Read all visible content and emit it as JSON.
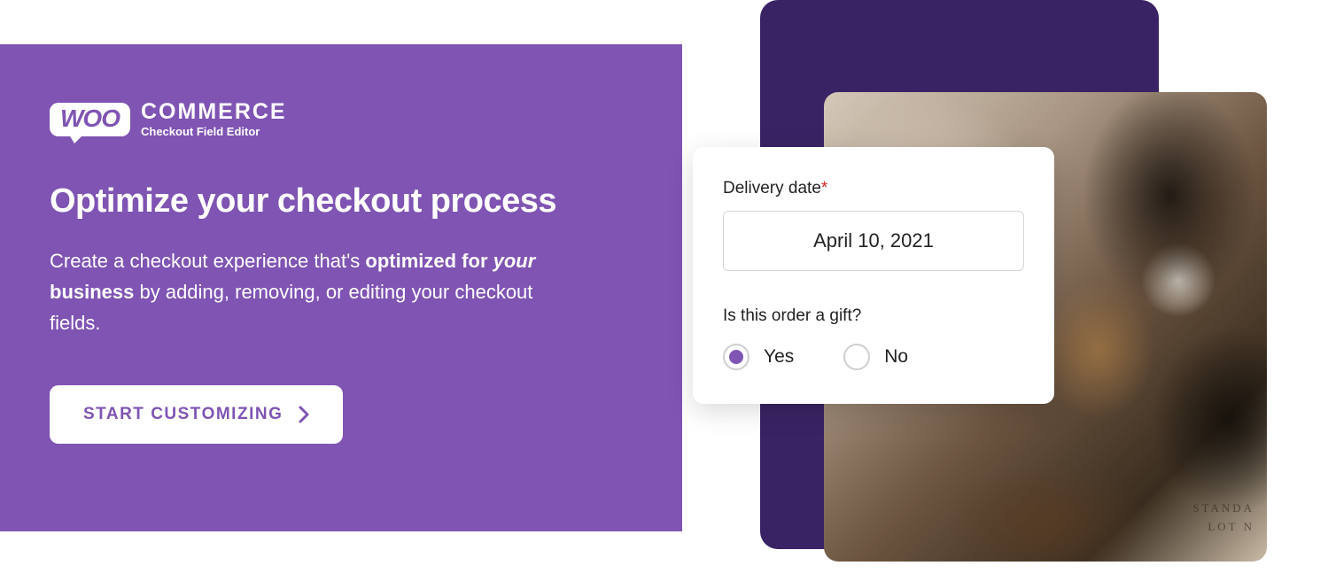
{
  "logo": {
    "woo": "WOO",
    "commerce": "COMMERCE",
    "subtitle": "Checkout Field Editor"
  },
  "headline": "Optimize your checkout process",
  "description_parts": {
    "p1": "Create a checkout experience that's ",
    "p2_strong_pre": "optimized for ",
    "p2_em": "your",
    "p2_strong_post": " business",
    "p3": " by adding, removing, or editing your checkout fields."
  },
  "cta": {
    "label": "START CUSTOMIZING"
  },
  "form": {
    "delivery_label": "Delivery date",
    "delivery_value": "April 10, 2021",
    "gift_label": "Is this order a gift?",
    "options": {
      "yes": "Yes",
      "no": "No"
    },
    "selected": "yes"
  },
  "colors": {
    "brand_purple": "#7f54b3",
    "dark_purple": "#3a2364"
  }
}
